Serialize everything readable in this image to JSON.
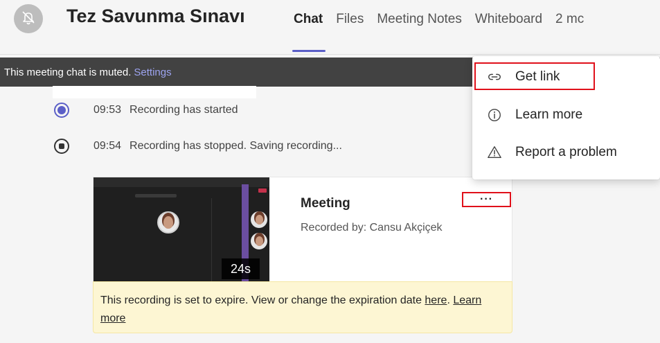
{
  "header": {
    "title": "Tez Savunma Sınavı",
    "tabs": [
      {
        "label": "Chat",
        "active": true
      },
      {
        "label": "Files",
        "active": false
      },
      {
        "label": "Meeting Notes",
        "active": false
      },
      {
        "label": "Whiteboard",
        "active": false
      },
      {
        "label": "2 mc",
        "active": false
      }
    ],
    "avatar_icon": "bell-off-icon"
  },
  "muted_bar": {
    "text": "This meeting chat is muted.",
    "settings_link": "Settings"
  },
  "events": [
    {
      "icon": "recording-started-icon",
      "time": "09:53",
      "text": "Recording has started"
    },
    {
      "icon": "recording-stopped-icon",
      "time": "09:54",
      "text": "Recording has stopped. Saving recording..."
    }
  ],
  "recording_card": {
    "title": "Meeting",
    "subtitle": "Recorded by: Cansu Akçiçek",
    "duration": "24s",
    "more_label": "···"
  },
  "expiry_banner": {
    "text_before": "This recording is set to expire. View or change the expiration date ",
    "here_link": "here",
    "after_here": ". ",
    "learn_more_link": "Learn more"
  },
  "context_menu": {
    "items": [
      {
        "icon": "link-icon",
        "label": "Get link"
      },
      {
        "icon": "info-icon",
        "label": "Learn more"
      },
      {
        "icon": "warning-icon",
        "label": "Report a problem"
      }
    ]
  },
  "colors": {
    "accent": "#5b5fc7",
    "muted_bar_bg": "#424242",
    "settings_link": "#9da4f0",
    "highlight_red": "#e0101a",
    "expiry_bg": "#fdf6d3"
  }
}
